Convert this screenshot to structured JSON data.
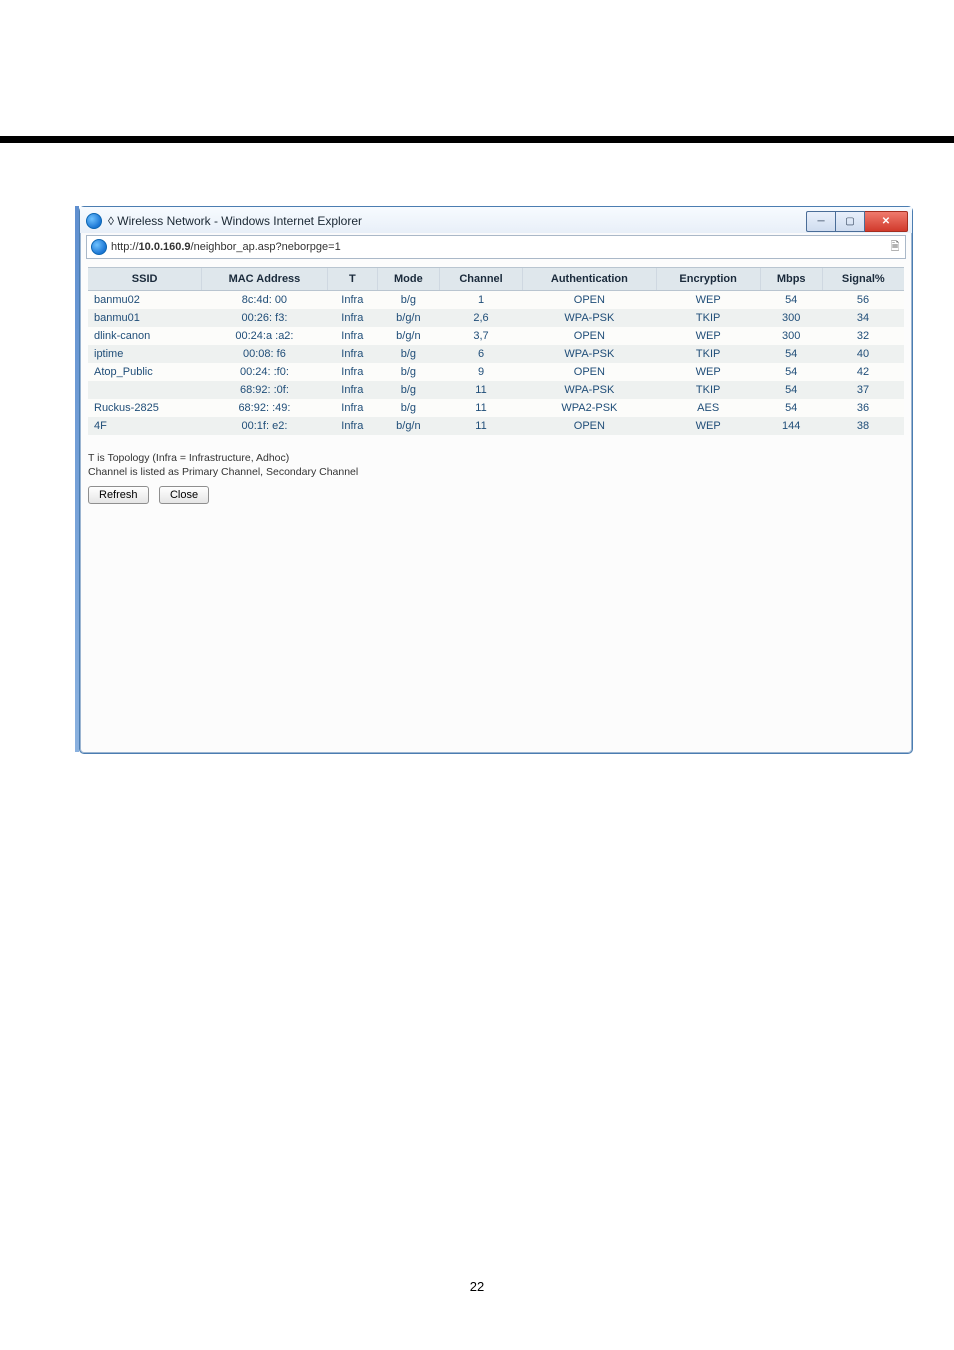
{
  "window": {
    "title": "◊ Wireless Network - Windows Internet Explorer",
    "url_host": "10.0.160.9",
    "url_path": "/neighbor_ap.asp?neborpge=1"
  },
  "columns": [
    "SSID",
    "MAC Address",
    "T",
    "Mode",
    "Channel",
    "Authentication",
    "Encryption",
    "Mbps",
    "Signal%"
  ],
  "rows": [
    {
      "ssid": "banmu02",
      "mac": "8c:4d:   00",
      "t": "Infra",
      "mode": "b/g",
      "channel": "1",
      "auth": "OPEN",
      "enc": "WEP",
      "mbps": "54",
      "signal": "56"
    },
    {
      "ssid": "banmu01",
      "mac": "00:26:   f3:",
      "t": "Infra",
      "mode": "b/g/n",
      "channel": "2,6",
      "auth": "WPA-PSK",
      "enc": "TKIP",
      "mbps": "300",
      "signal": "34"
    },
    {
      "ssid": "dlink-canon",
      "mac": "00:24:a  :a2:",
      "t": "Infra",
      "mode": "b/g/n",
      "channel": "3,7",
      "auth": "OPEN",
      "enc": "WEP",
      "mbps": "300",
      "signal": "32"
    },
    {
      "ssid": "iptime",
      "mac": "00:08:   f6",
      "t": "Infra",
      "mode": "b/g",
      "channel": "6",
      "auth": "WPA-PSK",
      "enc": "TKIP",
      "mbps": "54",
      "signal": "40"
    },
    {
      "ssid": "Atop_Public",
      "mac": "00:24:  :f0:",
      "t": "Infra",
      "mode": "b/g",
      "channel": "9",
      "auth": "OPEN",
      "enc": "WEP",
      "mbps": "54",
      "signal": "42"
    },
    {
      "ssid": "",
      "mac": "68:92:  :0f:",
      "t": "Infra",
      "mode": "b/g",
      "channel": "11",
      "auth": "WPA-PSK",
      "enc": "TKIP",
      "mbps": "54",
      "signal": "37"
    },
    {
      "ssid": "Ruckus-2825",
      "mac": "68:92:  :49:",
      "t": "Infra",
      "mode": "b/g",
      "channel": "11",
      "auth": "WPA2-PSK",
      "enc": "AES",
      "mbps": "54",
      "signal": "36"
    },
    {
      "ssid": "4F",
      "mac": "00:1f:   e2:",
      "t": "Infra",
      "mode": "b/g/n",
      "channel": "11",
      "auth": "OPEN",
      "enc": "WEP",
      "mbps": "144",
      "signal": "38"
    }
  ],
  "notes": {
    "line1": "T is Topology (Infra = Infrastructure, Adhoc)",
    "line2": "Channel is listed as Primary Channel, Secondary Channel"
  },
  "buttons": {
    "refresh": "Refresh",
    "close": "Close"
  },
  "page_number": "22"
}
